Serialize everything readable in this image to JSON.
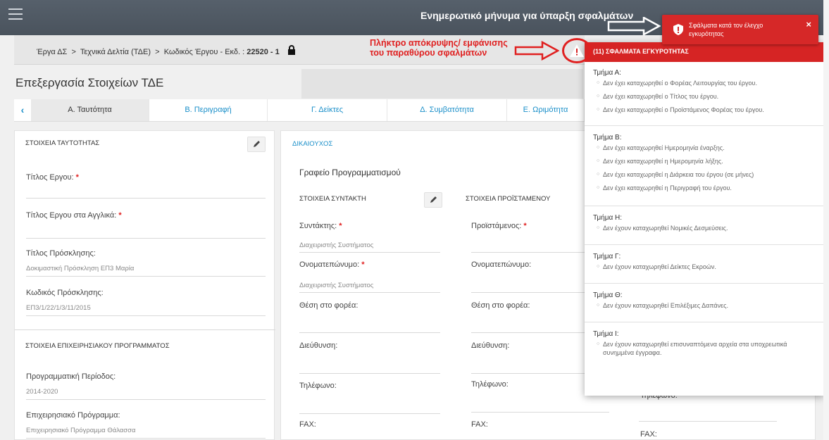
{
  "annotations": {
    "top": "Ενημερωτικό μήνυμα για ύπαρξη σφαλμάτων",
    "button_line1": "Πλήκτρο απόκρυψης/ εμφάνισης",
    "button_line2": "του παραθύρου σφαλμάτων"
  },
  "breadcrumb": {
    "part1": "Έργα ΔΣ",
    "sep": ">",
    "part2": "Τεχνικά Δελτία (ΤΔΕ)",
    "part3": "Κωδικός Έργου - Εκδ. :",
    "code": "22520 - 1"
  },
  "page_title": "Επεξεργασία Στοιχείων ΤΔΕ",
  "tabs": [
    {
      "label": "Α. Ταυτότητα"
    },
    {
      "label": "Β. Περιγραφή"
    },
    {
      "label": "Γ. Δείκτες"
    },
    {
      "label": "Δ. Συμβατότητα"
    },
    {
      "label": "Ε. Ωριμότητα"
    }
  ],
  "left_card": {
    "section1": "ΣΤΟΙΧΕΙΑ ΤΑΥΤΟΤΗΤΑΣ",
    "title_label": "Τίτλος Εργου:",
    "title_en_label": "Τίτλος Εργου στα Αγγλικά:",
    "call_title_label": "Τίτλος Πρόσκλησης:",
    "call_title_value": "Δοκιμαστική Πρόσκληση ΕΠ3 Μαρία",
    "call_code_label": "Κωδικός Πρόσκλησης:",
    "call_code_value": "ΕΠ3/1/22/1/3/11/2015",
    "section2": "ΣΤΟΙΧΕΙΑ ΕΠΙΧΕΙΡΗΣΙΑΚΟΥ ΠΡΟΓΡΑΜΜΑΤΟΣ",
    "period_label": "Προγραμματική Περίοδος:",
    "period_value": "2014-2020",
    "program_label": "Επιχειρησιακό Πρόγραμμα:",
    "program_value": "Επιχειρησιακό Πρόγραμμα Θάλασσα"
  },
  "right_card": {
    "beneficiary": "ΔΙΚΑΙΟΥΧΟΣ",
    "org_name": "Γραφείο Προγραμματισμού",
    "author_section": "ΣΤΟΙΧΕΙΑ ΣΥΝΤΑΚΤΗ",
    "head_section": "ΣΤΟΙΧΕΙΑ ΠΡΟΪΣΤΑΜΕΝΟΥ",
    "author_label": "Συντάκτης:",
    "author_value": "Διαχειριστής Συστήματος",
    "fullname_label": "Ονοματεπώνυμο:",
    "fullname_value": "Διαχειριστής Συστήματος",
    "position_label": "Θέση στο φορέα:",
    "address_label": "Διεύθυνση:",
    "phone_label": "Τηλέφωνο:",
    "fax_label": "FAX:",
    "head_label": "Προϊστάμενος:",
    "head_fullname_label": "Ονοματεπώνυμο:",
    "head_position_label": "Θέση στο φορέα:",
    "head_address_label": "Διεύθυνση:",
    "head_phone_label": "Τηλέφωνο:",
    "head_fax_label": "FAX:",
    "third_phone_label": "Τηλέφωνο:",
    "third_fax_label": "FAX:"
  },
  "error_panel": {
    "header": "(11) ΣΦΑΛΜΑΤΑ ΕΓΚΥΡΟΤΗΤΑΣ",
    "groups": [
      {
        "title": "Τμήμα Α:",
        "items": [
          "Δεν έχει καταχωρηθεί ο Φορέας Λειτουργίας του έργου.",
          "Δεν έχει καταχωρηθεί ο Τίτλος του έργου.",
          "Δεν έχει καταχωρηθεί ο Προϊστάμενος Φορέας του έργου."
        ]
      },
      {
        "title": "Τμήμα Β:",
        "items": [
          "Δεν έχει καταχωρηθεί Ημερομηνία έναρξης.",
          "Δεν έχει καταχωρηθεί η Ημερομηνία λήξης.",
          "Δεν έχει καταχωρηθεί η Διάρκεια του έργου (σε μήνες)",
          "Δεν έχει καταχωρηθεί η Περιγραφή του έργου."
        ]
      },
      {
        "title": "Τμήμα Η:",
        "items": [
          "Δεν έχουν καταχωρηθεί Νομικές Δεσμεύσεις."
        ]
      },
      {
        "title": "Τμήμα Γ:",
        "items": [
          "Δεν έχουν καταχωρηθεί Δείκτες Εκροών."
        ]
      },
      {
        "title": "Τμήμα Θ:",
        "items": [
          "Δεν έχουν καταχωρηθεί Επιλέξιμες Δαπάνες."
        ]
      },
      {
        "title": "Τμήμα Ι:",
        "items": [
          "Δεν έχουν καταχωρηθεί επισυναπτόμενα αρχεία στα υποχρεωτικά συνημμένα έγγραφα."
        ]
      }
    ]
  },
  "toast": {
    "message": "Σφάλματα κατά τον έλεγχο εγκυρότητας",
    "close": "×"
  },
  "colors": {
    "topbar": "#4f5862",
    "error_red": "#d62424",
    "link_blue": "#1a8fc9"
  }
}
